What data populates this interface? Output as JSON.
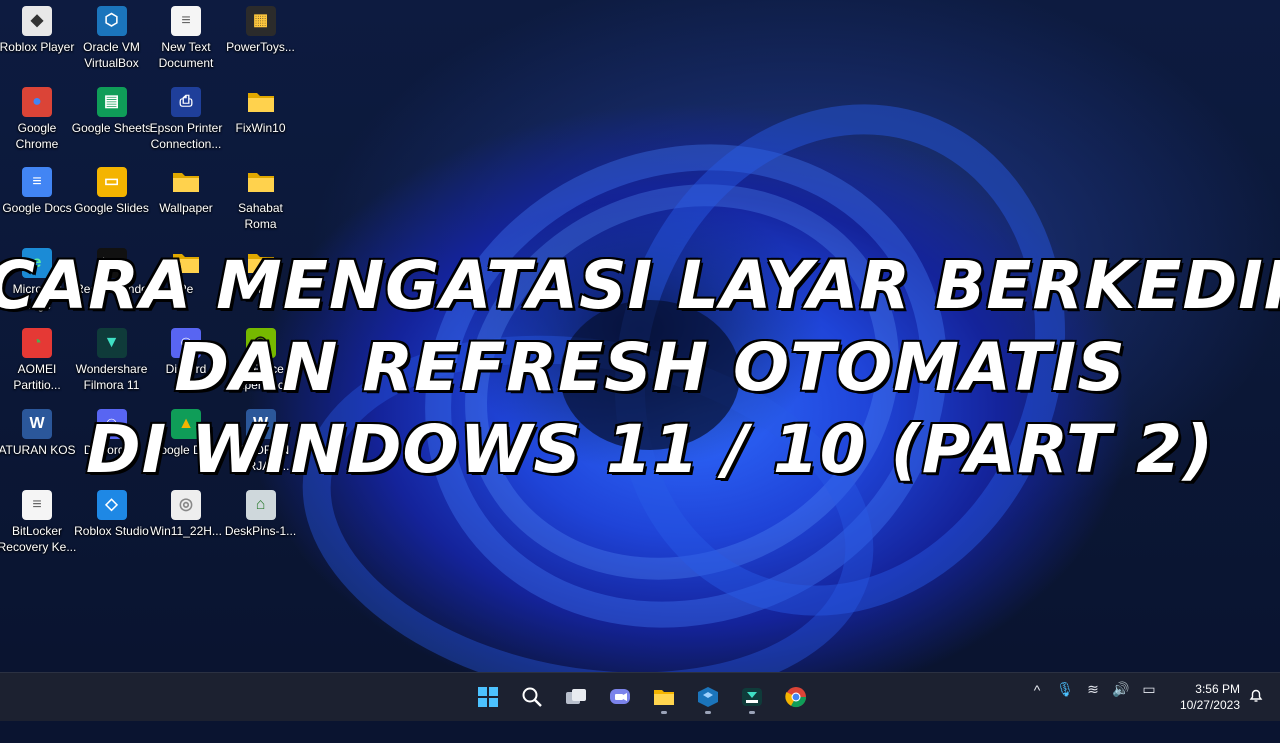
{
  "desktop_icons": [
    {
      "label": "Roblox Player",
      "icon": "roblox-player-icon"
    },
    {
      "label": "Oracle VM VirtualBox",
      "icon": "virtualbox-icon"
    },
    {
      "label": "New Text Document",
      "icon": "text-document-icon"
    },
    {
      "label": "PowerToys...",
      "icon": "powertoys-icon"
    },
    {
      "label": "Google Chrome",
      "icon": "chrome-icon"
    },
    {
      "label": "Google Sheets",
      "icon": "google-sheets-icon"
    },
    {
      "label": "Epson Printer Connection...",
      "icon": "epson-printer-icon"
    },
    {
      "label": "FixWin10",
      "icon": "folder-icon"
    },
    {
      "label": "Google Docs",
      "icon": "google-docs-icon"
    },
    {
      "label": "Google Slides",
      "icon": "google-slides-icon"
    },
    {
      "label": "Wallpaper",
      "icon": "folder-icon"
    },
    {
      "label": "Sahabat Roma",
      "icon": "folder-icon"
    },
    {
      "label": "Microsoft Edge",
      "icon": "edge-icon"
    },
    {
      "label": "Restar Windo",
      "icon": "cmd-shortcut-icon"
    },
    {
      "label": "Pe",
      "icon": "folder-icon"
    },
    {
      "label": "r",
      "icon": "folder-icon"
    },
    {
      "label": "AOMEI Partitio...",
      "icon": "aomei-partition-icon"
    },
    {
      "label": "Wondershare Filmora 11",
      "icon": "filmora-icon"
    },
    {
      "label": "Discord",
      "icon": "discord-icon"
    },
    {
      "label": "GeForce Experience",
      "icon": "geforce-icon"
    },
    {
      "label": "ATURAN KOS",
      "icon": "word-document-icon"
    },
    {
      "label": "DiscordSe",
      "icon": "discord-icon"
    },
    {
      "label": "Google Drive",
      "icon": "google-drive-icon"
    },
    {
      "label": "LAPORAN KERJA P...",
      "icon": "word-document-icon"
    },
    {
      "label": "BitLocker Recovery Ke...",
      "icon": "text-document-icon"
    },
    {
      "label": "Roblox Studio",
      "icon": "roblox-studio-icon"
    },
    {
      "label": "Win11_22H...",
      "icon": "disc-image-icon"
    },
    {
      "label": "DeskPins-1...",
      "icon": "deskpins-installer-icon"
    }
  ],
  "headline": {
    "line1": "CARA MENGATASI LAYAR BERKEDIP",
    "line2": "DAN REFRESH OTOMATIS",
    "line3": "DI WINDOWS 11 / 10 (PART 2)"
  },
  "taskbar": {
    "apps": [
      {
        "icon": "windows-start-icon"
      },
      {
        "icon": "search-icon"
      },
      {
        "icon": "task-view-icon"
      },
      {
        "icon": "teams-chat-icon"
      },
      {
        "icon": "file-explorer-icon"
      },
      {
        "icon": "virtualbox-icon"
      },
      {
        "icon": "filmora-icon"
      },
      {
        "icon": "chrome-icon"
      }
    ],
    "tray": {
      "chevron": "^",
      "mic": "🎙",
      "wifi": "≋",
      "volume": "🔊",
      "battery": "▭"
    },
    "time": "3:56 PM",
    "date": "10/27/2023"
  },
  "colors": {
    "accent_blue": "#2f6bff",
    "taskbar": "#1c2130"
  }
}
